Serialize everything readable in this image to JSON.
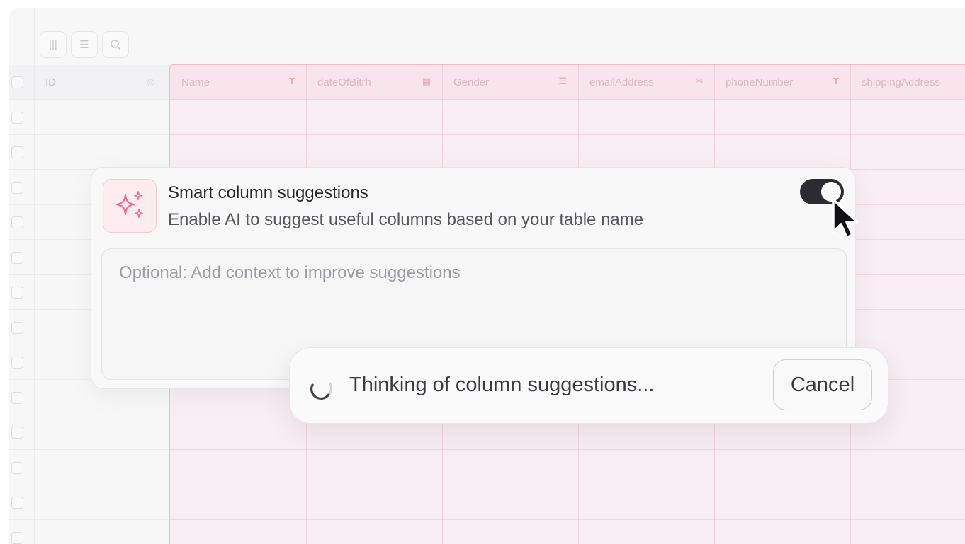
{
  "table": {
    "id_header": "ID",
    "columns": [
      {
        "label": "Name",
        "icon": "T",
        "icon_name": "text-type-icon"
      },
      {
        "label": "dateOfBitrh",
        "icon": "▦",
        "icon_name": "calendar-icon"
      },
      {
        "label": "Gender",
        "icon": "☰",
        "icon_name": "list-icon"
      },
      {
        "label": "emailAddress",
        "icon": "✉",
        "icon_name": "email-icon"
      },
      {
        "label": "phoneNumber",
        "icon": "T",
        "icon_name": "text-type-icon"
      },
      {
        "label": "shippingAddress",
        "icon": "",
        "icon_name": ""
      }
    ]
  },
  "card": {
    "title": "Smart column suggestions",
    "subtitle": "Enable AI to suggest useful columns based on your table name",
    "toggle_on": true,
    "context_placeholder": "Optional: Add context to improve suggestions"
  },
  "status": {
    "message": "Thinking of column suggestions...",
    "cancel_label": "Cancel"
  },
  "colors": {
    "accent_pink": "#f06e8c",
    "toggle_dark": "#2c2c30"
  }
}
